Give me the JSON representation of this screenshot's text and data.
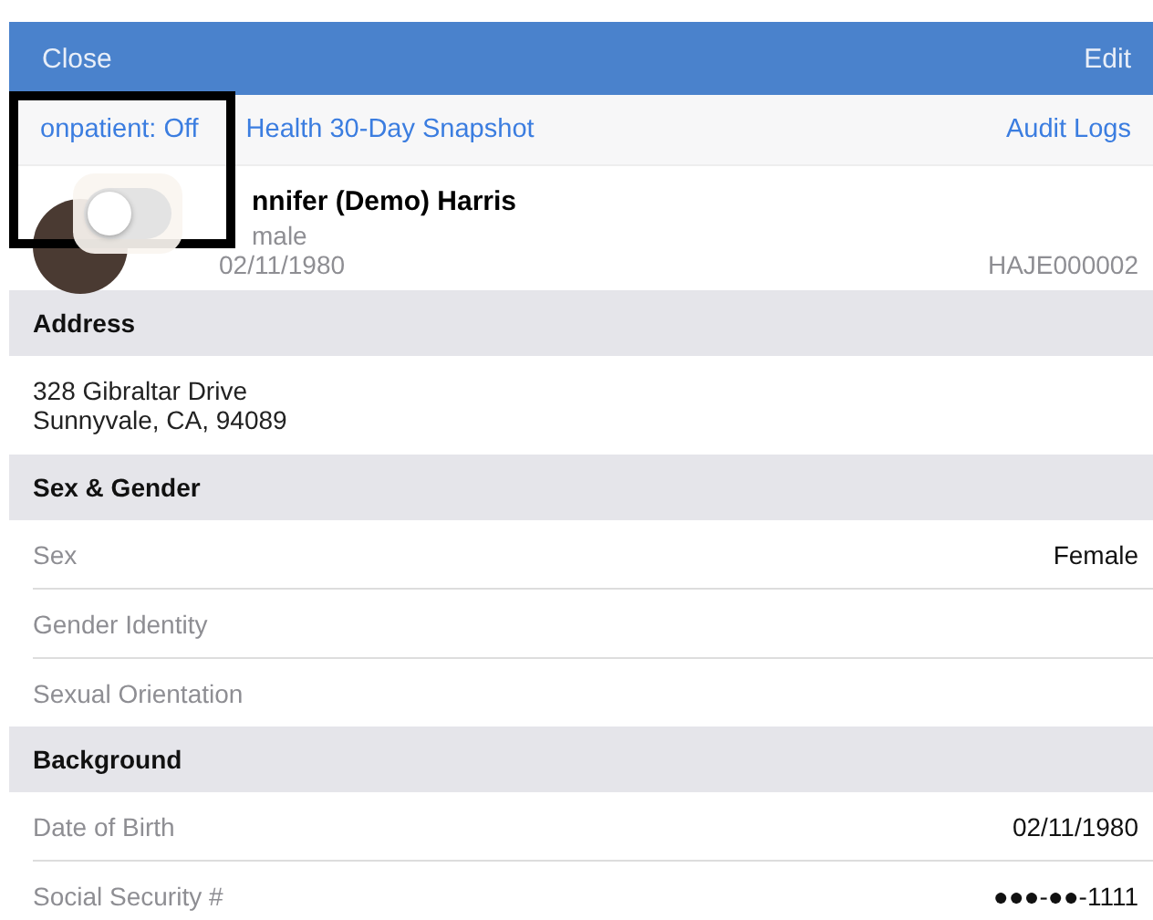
{
  "nav_bar": {
    "left_button": "Close",
    "right_button": "Edit"
  },
  "toolbar": {
    "items": [
      {
        "label": "onpatient: Off"
      },
      {
        "label": "Health 30-Day Snapshot"
      },
      {
        "label": "Audit Logs"
      }
    ]
  },
  "patient": {
    "name": "nnifer (Demo) Harris",
    "sex": "male",
    "dob": "02/11/1980",
    "id": "HAJE000002"
  },
  "popover": {
    "toggle": {
      "on": false
    }
  },
  "sections": [
    {
      "title": "Address",
      "kind": "text",
      "lines": [
        "328 Gibraltar Drive",
        "Sunnyvale, CA, 94089"
      ]
    },
    {
      "title": "Sex & Gender",
      "kind": "fields",
      "rows": [
        {
          "label": "Sex",
          "value": "Female"
        },
        {
          "label": "Gender Identity"
        },
        {
          "label": "Sexual Orientation"
        }
      ]
    },
    {
      "title": "Background",
      "kind": "fields",
      "rows": [
        {
          "label": "Date of Birth",
          "value": "02/11/1980"
        },
        {
          "label": "Social Security #",
          "value": "●●●-●●-1111"
        }
      ]
    }
  ]
}
